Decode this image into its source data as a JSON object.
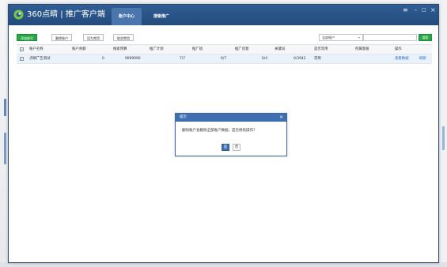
{
  "app": {
    "title": "360点睛 | 推广客户端",
    "tabs": [
      {
        "label": "账户中心",
        "active": true
      },
      {
        "label": "搜索推广",
        "active": false
      }
    ],
    "window_controls": {
      "menu": "≡",
      "minimize": "-",
      "maximize": "□",
      "close": "×"
    }
  },
  "toolbar": {
    "add_account": "添加账号",
    "delete_account": "删除账户",
    "set_common": "设为常用",
    "cancel_common": "取消常用",
    "account_filter": "全部账户",
    "search_placeholder": "",
    "query": "搜索"
  },
  "table": {
    "columns": [
      "账户名称",
      "账户余额",
      "搜索预算",
      "推广计划",
      "推广组",
      "推广创意",
      "关键词",
      "是否常用",
      "所属客服",
      "操作"
    ],
    "rows": [
      {
        "checked": true,
        "name": "点睛广告测试",
        "balance": "0",
        "budget": "9999990",
        "plans": "7/7",
        "groups": "6/7",
        "creatives": "0/4",
        "keywords": "0/3942",
        "common": "常用",
        "service": "",
        "actions": [
          "查看数据",
          "刷新"
        ]
      }
    ]
  },
  "dialog": {
    "title": "提示",
    "message": "删除账户会删除全部账户数据，是否继续操作？",
    "yes": "是",
    "no": "否",
    "close": "×"
  },
  "colors": {
    "titlebar": "#2f5d94",
    "accent_green": "#27a844",
    "dialog_blue": "#3e70b1",
    "link": "#2a6fc4"
  }
}
